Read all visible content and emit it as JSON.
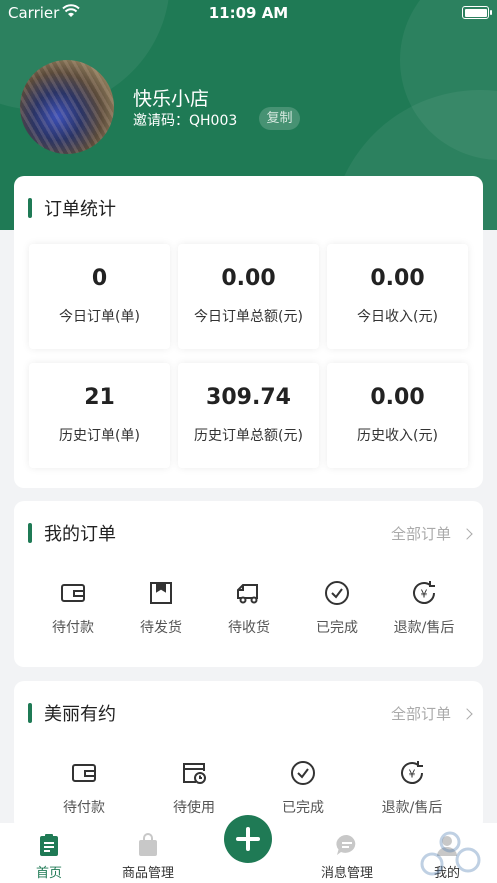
{
  "status_bar": {
    "carrier": "Carrier",
    "time": "11:09 AM"
  },
  "profile": {
    "shop_name": "快乐小店",
    "invite_label": "邀请码：",
    "invite_code": "QH003",
    "copy_label": "复制"
  },
  "stats": {
    "title": "订单统计",
    "items": [
      {
        "value": "0",
        "label": "今日订单(单)"
      },
      {
        "value": "0.00",
        "label": "今日订单总额(元)"
      },
      {
        "value": "0.00",
        "label": "今日收入(元)"
      },
      {
        "value": "21",
        "label": "历史订单(单)"
      },
      {
        "value": "309.74",
        "label": "历史订单总额(元)"
      },
      {
        "value": "0.00",
        "label": "历史收入(元)"
      }
    ]
  },
  "my_orders": {
    "title": "我的订单",
    "more": "全部订单",
    "items": [
      {
        "label": "待付款",
        "icon": "wallet-icon"
      },
      {
        "label": "待发货",
        "icon": "box-icon"
      },
      {
        "label": "待收货",
        "icon": "truck-icon"
      },
      {
        "label": "已完成",
        "icon": "check-circle-icon"
      },
      {
        "label": "退款/售后",
        "icon": "refund-icon"
      }
    ]
  },
  "beauty": {
    "title": "美丽有约",
    "more": "全部订单",
    "items": [
      {
        "label": "待付款",
        "icon": "wallet-icon"
      },
      {
        "label": "待使用",
        "icon": "calendar-clock-icon"
      },
      {
        "label": "已完成",
        "icon": "check-circle-icon"
      },
      {
        "label": "退款/售后",
        "icon": "refund-icon"
      }
    ]
  },
  "tabbar": {
    "items": [
      {
        "label": "首页",
        "icon": "clipboard-icon",
        "active": true
      },
      {
        "label": "商品管理",
        "icon": "bag-icon"
      },
      {
        "label": "",
        "icon": "plus-icon"
      },
      {
        "label": "消息管理",
        "icon": "chat-icon"
      },
      {
        "label": "我的",
        "icon": "person-icon"
      }
    ]
  },
  "colors": {
    "brand": "#1f7a55",
    "background": "#f2f3f5"
  }
}
